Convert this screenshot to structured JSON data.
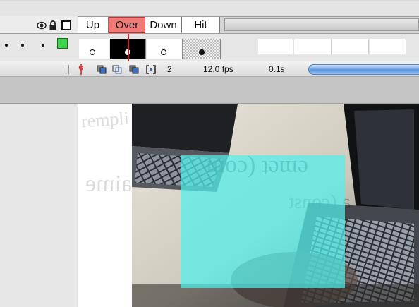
{
  "window": {
    "layer_icons": [
      "eye-icon",
      "lock-icon",
      "outline-icon"
    ]
  },
  "frames": {
    "tabs": [
      {
        "label": "Up",
        "active": false
      },
      {
        "label": "Over",
        "active": true
      },
      {
        "label": "Down",
        "active": false
      },
      {
        "label": "Hit",
        "active": false
      }
    ]
  },
  "layer": {
    "color": "#3ed14a",
    "keyframes": [
      "blank",
      "filled-current",
      "blank",
      "filled"
    ]
  },
  "status": {
    "current_frame": "2",
    "frame_rate": "12.0 fps",
    "elapsed_time": "0.1s"
  },
  "stage": {
    "ghost_text": [
      "emet (com",
      "aime",
      "a (const",
      "rempli"
    ],
    "hit_area_color": "#50f0eb"
  }
}
